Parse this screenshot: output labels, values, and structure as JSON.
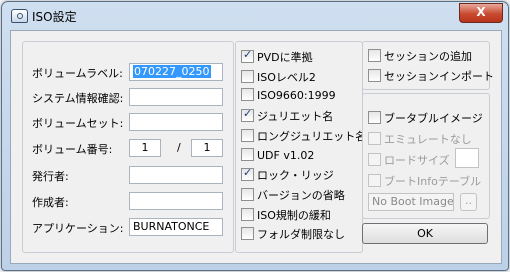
{
  "window": {
    "title": "ISO設定",
    "close_label": "X"
  },
  "left": {
    "volume_label": {
      "label": "ボリュームラベル:",
      "value": "070227_0250"
    },
    "system_id": {
      "label": "システム情報確認:",
      "value": ""
    },
    "volume_set": {
      "label": "ボリュームセット:",
      "value": ""
    },
    "volume_number": {
      "label": "ボリューム番号:",
      "value": "1",
      "separator": "/",
      "total": "1"
    },
    "publisher": {
      "label": "発行者:",
      "value": ""
    },
    "creator": {
      "label": "作成者:",
      "value": ""
    },
    "application": {
      "label": "アプリケーション:",
      "value": "BURNATONCE"
    }
  },
  "options": [
    {
      "label": "PVDに準拠",
      "checked": true
    },
    {
      "label": "ISOレベル2",
      "checked": false
    },
    {
      "label": "ISO9660:1999",
      "checked": false
    },
    {
      "label": "ジュリエット名",
      "checked": true
    },
    {
      "label": "ロングジュリエット名",
      "checked": false
    },
    {
      "label": "UDF v1.02",
      "checked": false
    },
    {
      "label": "ロック・リッジ",
      "checked": true
    },
    {
      "label": "バージョンの省略",
      "checked": false
    },
    {
      "label": "ISO規制の緩和",
      "checked": false
    },
    {
      "label": "フォルダ制限なし",
      "checked": false
    }
  ],
  "session": {
    "add_session": "セッションの追加",
    "import_session": "セッションインポート"
  },
  "boot": {
    "bootable": "ブータブルイメージ",
    "emulate_none": "エミュレートなし",
    "load_size": "ロードサイズ",
    "boot_info_table": "ブートInfoテーブル",
    "image_field": "No Boot Image",
    "browse": ".."
  },
  "ok_label": "OK"
}
